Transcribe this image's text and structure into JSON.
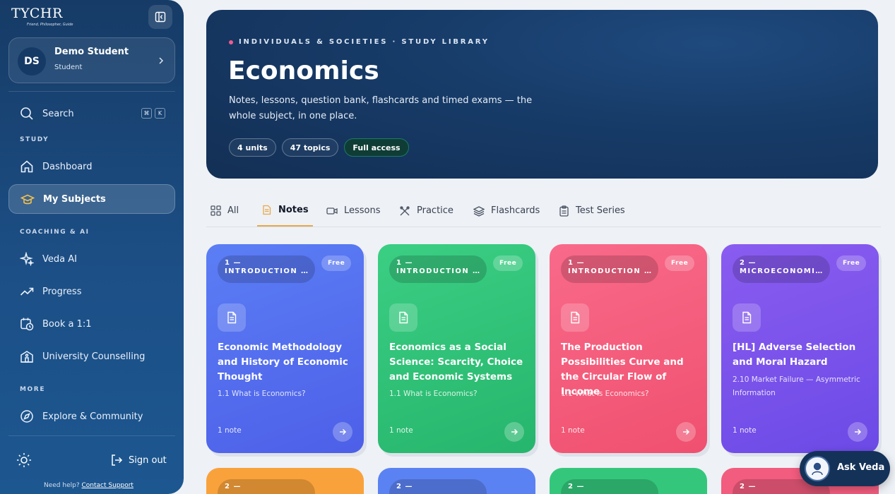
{
  "brand": {
    "logo_text": "TYCHR",
    "logo_tagline": "Friend, Philosopher, Guide"
  },
  "user": {
    "initials": "DS",
    "name": "Demo Student",
    "role": "Student"
  },
  "search": {
    "label": "Search",
    "shortcut_mod": "⌘",
    "shortcut_key": "K"
  },
  "sidebar": {
    "sections": [
      {
        "label": "STUDY"
      },
      {
        "label": "COACHING & AI"
      },
      {
        "label": "MORE"
      }
    ],
    "items": [
      {
        "label": "Dashboard",
        "icon": "home-icon"
      },
      {
        "label": "My Subjects",
        "icon": "graduation-cap-icon",
        "active": true
      },
      {
        "label": "Veda AI",
        "icon": "sparkles-icon"
      },
      {
        "label": "Progress",
        "icon": "trending-up-icon"
      },
      {
        "label": "Book a 1:1",
        "icon": "calendar-clock-icon"
      },
      {
        "label": "University Counselling",
        "icon": "school-icon"
      },
      {
        "label": "Explore & Community",
        "icon": "compass-icon"
      }
    ],
    "sign_out": "Sign out",
    "help_text": "Need help?",
    "help_link": "Contact Support"
  },
  "hero": {
    "eyebrow": "INDIVIDUALS & SOCIETIES · STUDY LIBRARY",
    "title": "Economics",
    "description": "Notes, lessons, question bank, flashcards and timed exams — the whole subject, in one place.",
    "chips": [
      "4 units",
      "47 topics",
      "Full access"
    ]
  },
  "tabs": [
    {
      "label": "All",
      "icon": "grid-icon"
    },
    {
      "label": "Notes",
      "icon": "notes-icon",
      "active": true
    },
    {
      "label": "Lessons",
      "icon": "video-icon"
    },
    {
      "label": "Practice",
      "icon": "practice-icon"
    },
    {
      "label": "Flashcards",
      "icon": "layers-icon"
    },
    {
      "label": "Test Series",
      "icon": "clipboard-icon"
    }
  ],
  "cards": [
    {
      "unit_num": "1 —",
      "unit_name": "INTRODUCTION TO ECONOMICS",
      "badge": "Free",
      "title": "Economic Methodology and History of Economic Thought",
      "subtitle": "1.1 What is Economics?",
      "count": "1 note",
      "color": "#4f6ef2"
    },
    {
      "unit_num": "1 —",
      "unit_name": "INTRODUCTION TO ECONOMICS",
      "badge": "Free",
      "title": "Economics as a Social Science: Scarcity, Choice and Economic Systems",
      "subtitle": "1.1 What is Economics?",
      "count": "1 note",
      "color": "#2fc47a"
    },
    {
      "unit_num": "1 —",
      "unit_name": "INTRODUCTION TO ECONOMICS",
      "badge": "Free",
      "title": "The Production Possibilities Curve and the Circular Flow of Income",
      "subtitle": "1.1 What is Economics?",
      "count": "1 note",
      "color": "#f25c7e"
    },
    {
      "unit_num": "2 —",
      "unit_name": "MICROECONOMICS",
      "badge": "Free",
      "title": "[HL] Adverse Selection and Moral Hazard",
      "subtitle": "2.10 Market Failure — Asymmetric Information",
      "count": "1 note",
      "color": "#7b55ec"
    }
  ],
  "peek_cards": [
    {
      "unit_num": "2 —",
      "color": "#f9a23b"
    },
    {
      "unit_num": "2 —",
      "color": "#5b82f2"
    },
    {
      "unit_num": "2 —",
      "color": "#34c77c"
    },
    {
      "unit_num": "2 —",
      "color": "#f25c7e"
    }
  ],
  "assistant": {
    "label": "Ask Veda"
  }
}
